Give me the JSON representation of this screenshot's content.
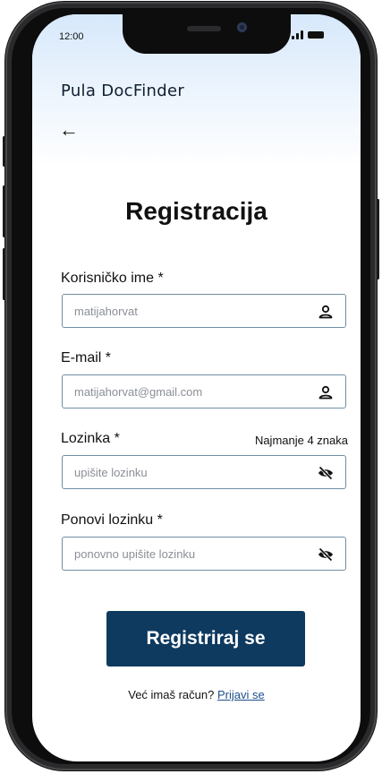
{
  "status_bar": {
    "time": "12:00"
  },
  "app": {
    "title": "Pula DocFinder"
  },
  "nav": {
    "back_icon": "arrow-left-icon"
  },
  "page": {
    "title": "Registracija"
  },
  "form": {
    "username": {
      "label": "Korisničko ime *",
      "placeholder": "matijahorvat",
      "icon": "user-icon"
    },
    "email": {
      "label": "E-mail *",
      "placeholder": "matijahorvat@gmail.com",
      "icon": "user-icon"
    },
    "password": {
      "label": "Lozinka *",
      "hint": "Najmanje 4 znaka",
      "placeholder": "upišite lozinku",
      "icon": "eye-off-icon"
    },
    "password_repeat": {
      "label": "Ponovi lozinku *",
      "placeholder": "ponovno upišite lozinku",
      "icon": "eye-off-icon"
    },
    "submit_label": "Registriraj se"
  },
  "footer": {
    "prompt": "Već imaš račun?",
    "login_link": "Prijavi se"
  },
  "colors": {
    "primary": "#0f3a5f",
    "field_border": "#6f8fa4",
    "link": "#1d4f8c",
    "header_gradient": "#d6e8fb"
  }
}
